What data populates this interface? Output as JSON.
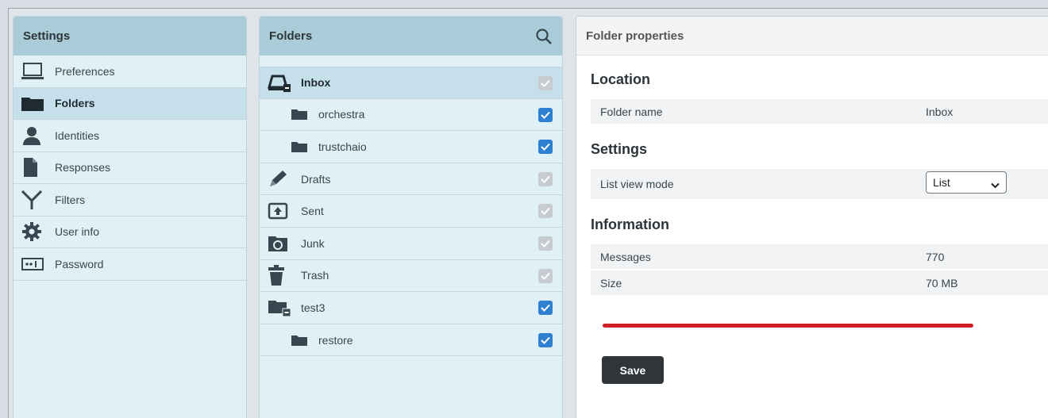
{
  "settings": {
    "title": "Settings",
    "items": [
      {
        "label": "Preferences",
        "icon": "laptop-icon"
      },
      {
        "label": "Folders",
        "icon": "folder-icon",
        "active": true
      },
      {
        "label": "Identities",
        "icon": "user-icon"
      },
      {
        "label": "Responses",
        "icon": "document-icon"
      },
      {
        "label": "Filters",
        "icon": "filter-icon"
      },
      {
        "label": "User info",
        "icon": "gear-icon"
      },
      {
        "label": "Password",
        "icon": "password-icon"
      }
    ]
  },
  "folders": {
    "title": "Folders",
    "items": [
      {
        "label": "Inbox",
        "icon": "inbox-icon",
        "checked": true,
        "enabled": false,
        "active": true
      },
      {
        "label": "orchestra",
        "icon": "folder-icon",
        "checked": true,
        "enabled": true
      },
      {
        "label": "trustchaio",
        "icon": "folder-icon",
        "checked": true,
        "enabled": true
      },
      {
        "label": "Drafts",
        "icon": "pencil-icon",
        "checked": true,
        "enabled": false
      },
      {
        "label": "Sent",
        "icon": "sent-icon",
        "checked": true,
        "enabled": false
      },
      {
        "label": "Junk",
        "icon": "junk-icon",
        "checked": true,
        "enabled": false
      },
      {
        "label": "Trash",
        "icon": "trash-icon",
        "checked": true,
        "enabled": false
      },
      {
        "label": "test3",
        "icon": "folder-collapse-icon",
        "checked": true,
        "enabled": true
      },
      {
        "label": "restore",
        "icon": "folder-icon",
        "checked": true,
        "enabled": true
      }
    ]
  },
  "props": {
    "title": "Folder properties",
    "location_title": "Location",
    "folder_name_label": "Folder name",
    "folder_name_value": "Inbox",
    "settings_title": "Settings",
    "list_view_label": "List view mode",
    "list_view_value": "List",
    "information_title": "Information",
    "messages_label": "Messages",
    "messages_value": "770",
    "size_label": "Size",
    "size_value": "70 MB",
    "save_label": "Save"
  },
  "colors": {
    "accent": "#2f80d1",
    "header": "#a9ccd8",
    "underline": "#cf2026"
  }
}
